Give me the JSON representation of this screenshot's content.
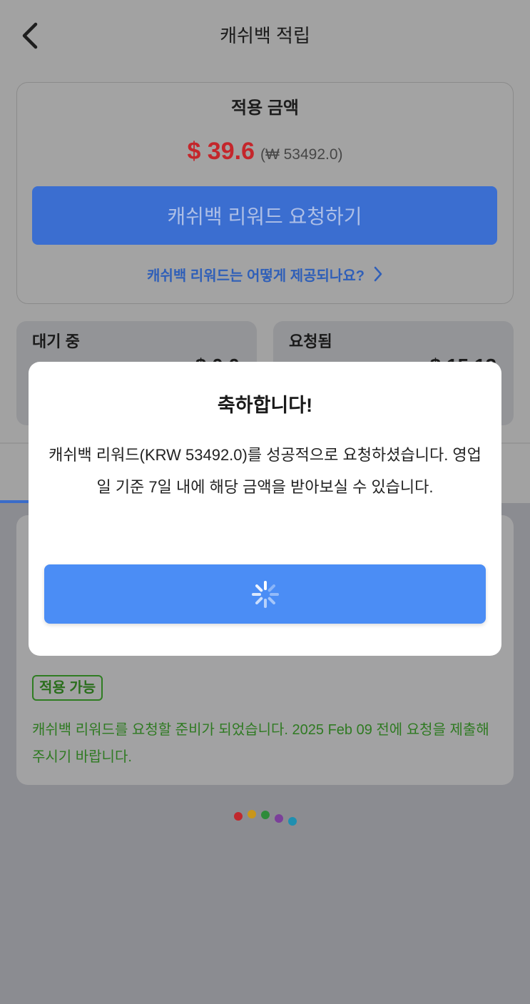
{
  "header": {
    "title": "캐쉬백 적립",
    "back_icon": "chevron-left-icon"
  },
  "summary": {
    "label": "적용 금액",
    "amount_usd": "$ 39.6",
    "amount_krw": "(₩ 53492.0)",
    "request_button": "캐쉬백 리워드 요청하기",
    "help_link": "캐쉬백 리워드는 어떻게 제공되나요?",
    "help_link_icon": "chevron-right-icon"
  },
  "stats": [
    {
      "label": "대기 중",
      "value": "$ 0.0"
    },
    {
      "label": "요청됨",
      "value": "$ 15.12"
    }
  ],
  "reward_card": {
    "status_badge": "적용 가능",
    "message": "캐쉬백 리워드를 요청할 준비가 되었습니다. 2025 Feb 09 전에 요청을 제출해 주시기 바랍니다."
  },
  "modal": {
    "title": "축하합니다!",
    "message": "캐쉬백 리워드(KRW 53492.0)를 성공적으로 요청하셨습니다. 영업일 기준 7일 내에 해당 금액을 받아보실 수 있습니다.",
    "button_icon": "spinner-icon"
  },
  "colors": {
    "accent": "#3b6ed0",
    "modal_button": "#4b8df5",
    "amount": "#c4262b",
    "success": "#2f7a22"
  },
  "loading_dots": {
    "colors": [
      "#c0282d",
      "#c9961a",
      "#2e8b3a",
      "#7b3f9a",
      "#1f8fb0"
    ]
  }
}
